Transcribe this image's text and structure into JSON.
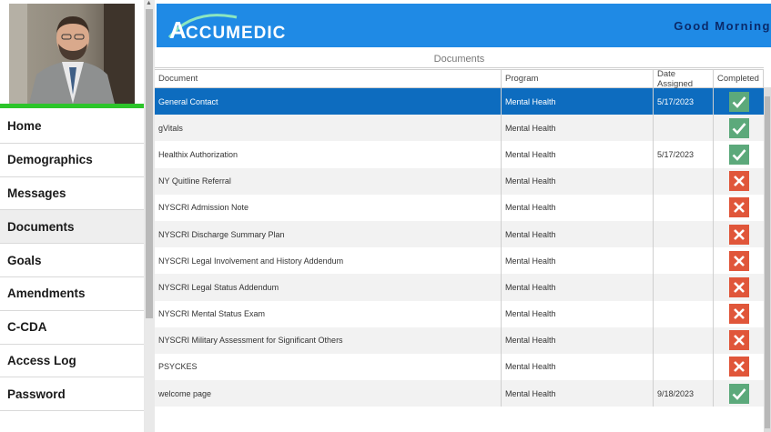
{
  "brand": {
    "logo_text": "ACCUMEDIC",
    "header_color": "#1f8ae5"
  },
  "greeting": "Good Morning",
  "sidebar": {
    "accent_color": "#2cc52a",
    "items": [
      {
        "label": "Home"
      },
      {
        "label": "Demographics"
      },
      {
        "label": "Messages"
      },
      {
        "label": "Documents"
      },
      {
        "label": "Goals"
      },
      {
        "label": "Amendments"
      },
      {
        "label": "C-CDA"
      },
      {
        "label": "Access Log"
      },
      {
        "label": "Password"
      }
    ],
    "active": "Documents"
  },
  "documents": {
    "title": "Documents",
    "columns": {
      "document": "Document",
      "program": "Program",
      "date": "Date Assigned",
      "completed": "Completed"
    },
    "rows": [
      {
        "document": "General Contact",
        "program": "Mental Health",
        "date": "5/17/2023",
        "completed": true
      },
      {
        "document": "gVitals",
        "program": "Mental Health",
        "date": "",
        "completed": true
      },
      {
        "document": "Healthix Authorization",
        "program": "Mental Health",
        "date": "5/17/2023",
        "completed": true
      },
      {
        "document": "NY Quitline Referral",
        "program": "Mental Health",
        "date": "",
        "completed": false
      },
      {
        "document": "NYSCRI Admission Note",
        "program": "Mental Health",
        "date": "",
        "completed": false
      },
      {
        "document": "NYSCRI Discharge Summary Plan",
        "program": "Mental Health",
        "date": "",
        "completed": false
      },
      {
        "document": "NYSCRI Legal Involvement and History Addendum",
        "program": "Mental Health",
        "date": "",
        "completed": false
      },
      {
        "document": "NYSCRI Legal Status Addendum",
        "program": "Mental Health",
        "date": "",
        "completed": false
      },
      {
        "document": "NYSCRI Mental Status Exam",
        "program": "Mental Health",
        "date": "",
        "completed": false
      },
      {
        "document": "NYSCRI Military Assessment for Significant Others",
        "program": "Mental Health",
        "date": "",
        "completed": false
      },
      {
        "document": "PSYCKES",
        "program": "Mental Health",
        "date": "",
        "completed": false
      },
      {
        "document": "welcome page",
        "program": "Mental Health",
        "date": "9/18/2023",
        "completed": true
      }
    ],
    "selected_row": 0,
    "complete_color": "#5ca97b",
    "incomplete_color": "#e0563a"
  }
}
